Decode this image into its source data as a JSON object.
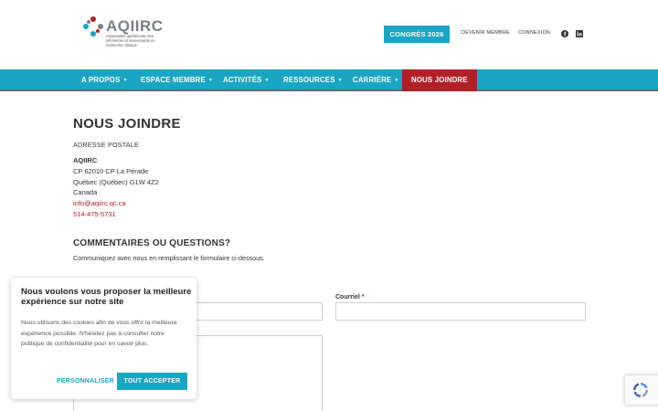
{
  "header": {
    "logo_name": "AQIIRC",
    "logo_tagline": "Association québécoise des infirmières et intervenants en recherche clinique",
    "congres_label": "CONGRÈS 2026",
    "become_member_label": "DEVENIR MEMBRE",
    "login_label": "CONNEXION",
    "icons": [
      "facebook-icon",
      "linkedin-icon"
    ]
  },
  "nav": {
    "items": [
      {
        "label": "A PROPOS"
      },
      {
        "label": "ESPACE MEMBRE"
      },
      {
        "label": "ACTIVITÉS"
      },
      {
        "label": "RESSOURCES"
      },
      {
        "label": "CARRIÈRE"
      },
      {
        "label": "NOUS JOINDRE"
      }
    ],
    "active_color": "#b12029",
    "bar_color": "#1aa5c2"
  },
  "main": {
    "title": "NOUS JOINDRE",
    "address_heading": "ADRESSE POSTALE",
    "org": "AQIIRC",
    "line1": "CP 62010 CP La Pérade",
    "line2": "Québec (Québec)  G1W 4Z2",
    "country": "Canada",
    "email": "info@aqiirc.qc.ca",
    "phone": "514-475-5731",
    "form_title": "COMMENTAIRES OU QUESTIONS?",
    "form_subtitle": "Communiquez avec nous en remplissant le formulaire ci-dessous.",
    "email_label": "Courriel",
    "required_mark": "*"
  },
  "cookie": {
    "title": "Nous voulons vous proposer la meilleure expérience sur notre site",
    "text": "Nous utilisons des cookies afin de vous offrir la meilleure expérience possible. N'hésitez pas à consulter notre politique de confidentialité pour en savoir plus.",
    "customize_label": "PERSONNALISER",
    "accept_label": "TOUT ACCEPTER"
  }
}
